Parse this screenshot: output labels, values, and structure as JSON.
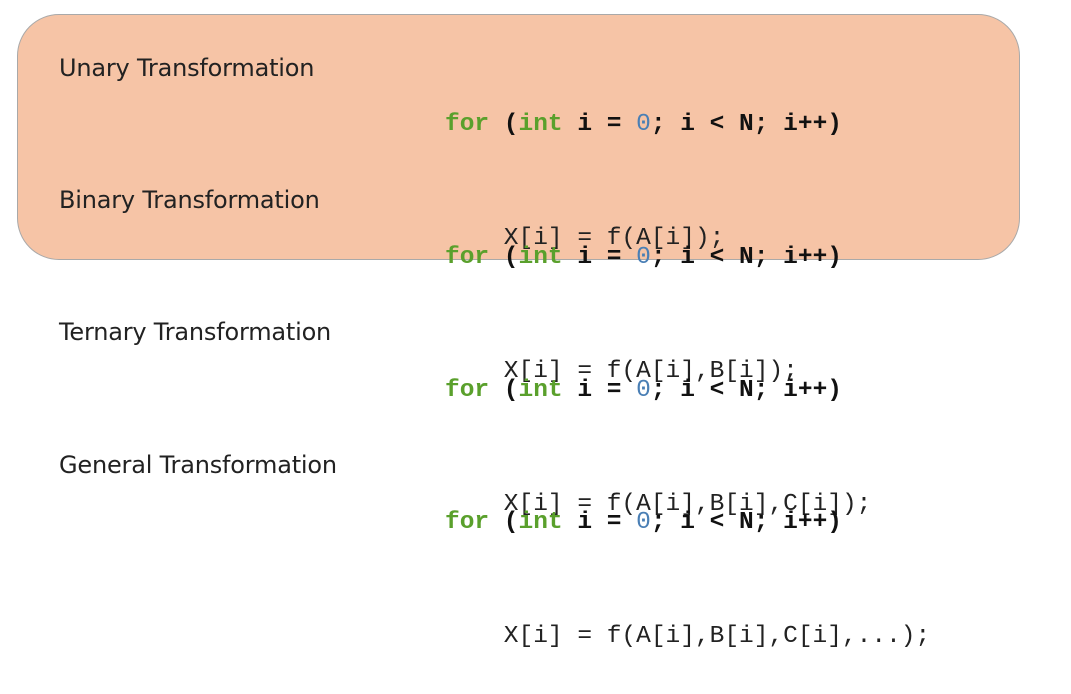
{
  "colors": {
    "highlight_fill": "#f6c4a6",
    "highlight_border": "#a9a9a9",
    "keyword": "#5aa02c",
    "number": "#4a7fb5",
    "text": "#222222"
  },
  "rows": [
    {
      "label": "Unary Transformation",
      "loop": {
        "kw_for": "for",
        "open": " (",
        "kw_int": "int",
        "mid1": " i = ",
        "zero": "0",
        "rest": "; i < N; i++)"
      },
      "body": "    X[i] = f(A[i]);"
    },
    {
      "label": "Binary Transformation",
      "loop": {
        "kw_for": "for",
        "open": " (",
        "kw_int": "int",
        "mid1": " i = ",
        "zero": "0",
        "rest": "; i < N; i++)"
      },
      "body": "    X[i] = f(A[i],B[i]);"
    },
    {
      "label": "Ternary Transformation",
      "loop": {
        "kw_for": "for",
        "open": " (",
        "kw_int": "int",
        "mid1": " i = ",
        "zero": "0",
        "rest": "; i < N; i++)"
      },
      "body": "    X[i] = f(A[i],B[i],C[i]);"
    },
    {
      "label": "General Transformation",
      "loop": {
        "kw_for": "for",
        "open": " (",
        "kw_int": "int",
        "mid1": " i = ",
        "zero": "0",
        "rest": "; i < N; i++)"
      },
      "body": "    X[i] = f(A[i],B[i],C[i],...);"
    }
  ]
}
